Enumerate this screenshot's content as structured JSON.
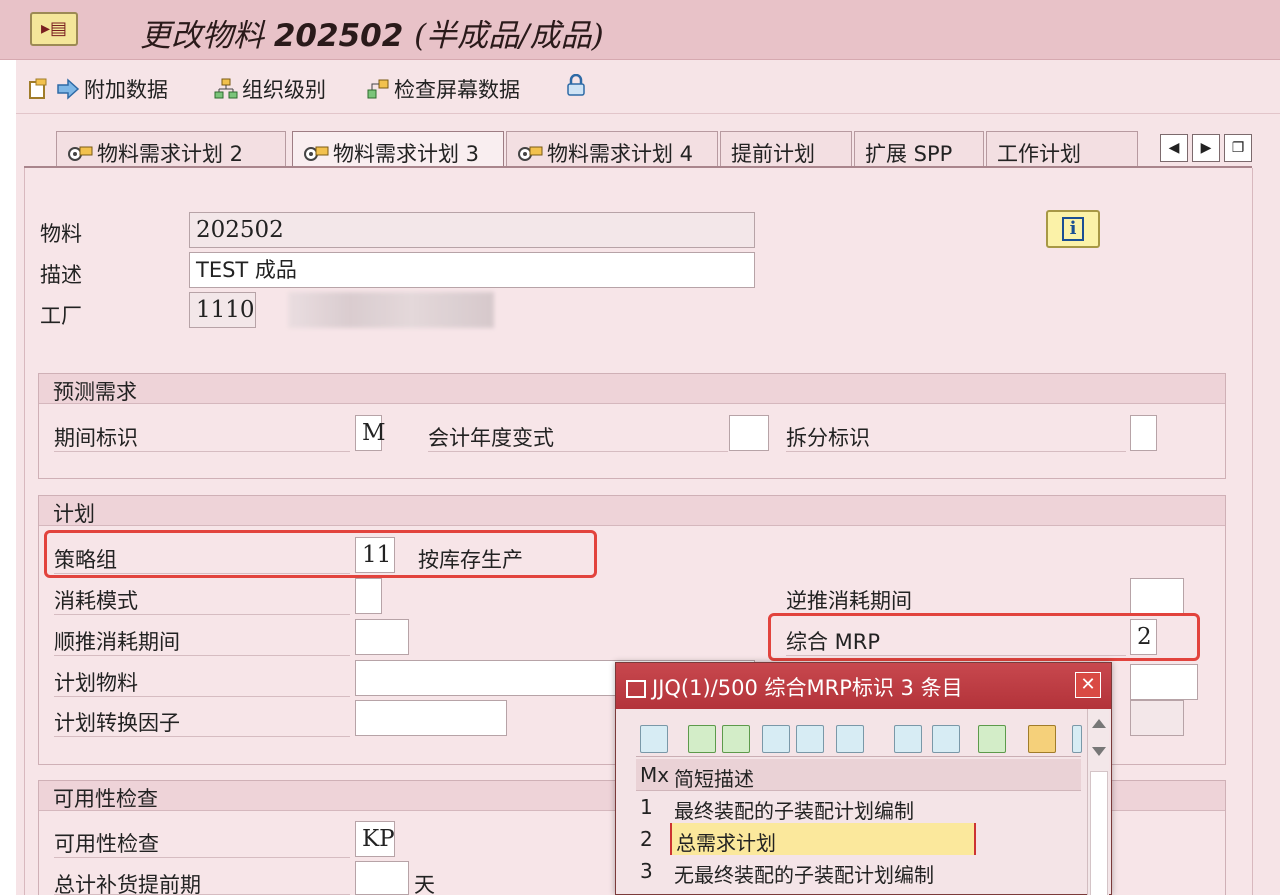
{
  "window": {
    "title_prefix": "更改物料 ",
    "title_number": "202502 ",
    "title_suffix": "(半成品/成品)"
  },
  "toolbar": {
    "additional_data": "附加数据",
    "org_levels": "组织级别",
    "check_screen_data": "检查屏幕数据"
  },
  "tabs": [
    {
      "label": "物料需求计划 2"
    },
    {
      "label": "物料需求计划 3"
    },
    {
      "label": "物料需求计划 4"
    },
    {
      "label": "提前计划"
    },
    {
      "label": "扩展 SPP"
    },
    {
      "label": "工作计划"
    }
  ],
  "header": {
    "material_label": "物料",
    "material_value": "202502",
    "description_label": "描述",
    "description_value": "TEST 成品",
    "plant_label": "工厂",
    "plant_value": "1110"
  },
  "forecast": {
    "title": "预测需求",
    "period_label": "期间标识",
    "period_value": "M",
    "fiscal_label": "会计年度变式",
    "fiscal_value": "",
    "split_label": "拆分标识",
    "split_value": ""
  },
  "planning": {
    "title": "计划",
    "strategy_label": "策略组",
    "strategy_value": "11",
    "strategy_desc": "按库存生产",
    "consumption_mode_label": "消耗模式",
    "backward_label": "逆推消耗期间",
    "forward_label": "顺推消耗期间",
    "mixed_mrp_label": "综合 MRP",
    "mixed_mrp_value": "2",
    "planning_material_label": "计划物料",
    "conversion_factor_label": "计划转换因子"
  },
  "availability": {
    "title": "可用性检查",
    "check_label": "可用性检查",
    "check_value": "KP",
    "lead_time_label": "总计补货提前期",
    "lead_time_unit": "天"
  },
  "popup": {
    "title": "JJQ(1)/500 综合MRP标识 3 条目",
    "close": "✕",
    "col_key": "Mx",
    "col_desc": "简短描述",
    "rows": [
      {
        "key": "1",
        "desc": "最终装配的子装配计划编制"
      },
      {
        "key": "2",
        "desc": "总需求计划"
      },
      {
        "key": "3",
        "desc": "无最终装配的子装配计划编制"
      }
    ]
  }
}
